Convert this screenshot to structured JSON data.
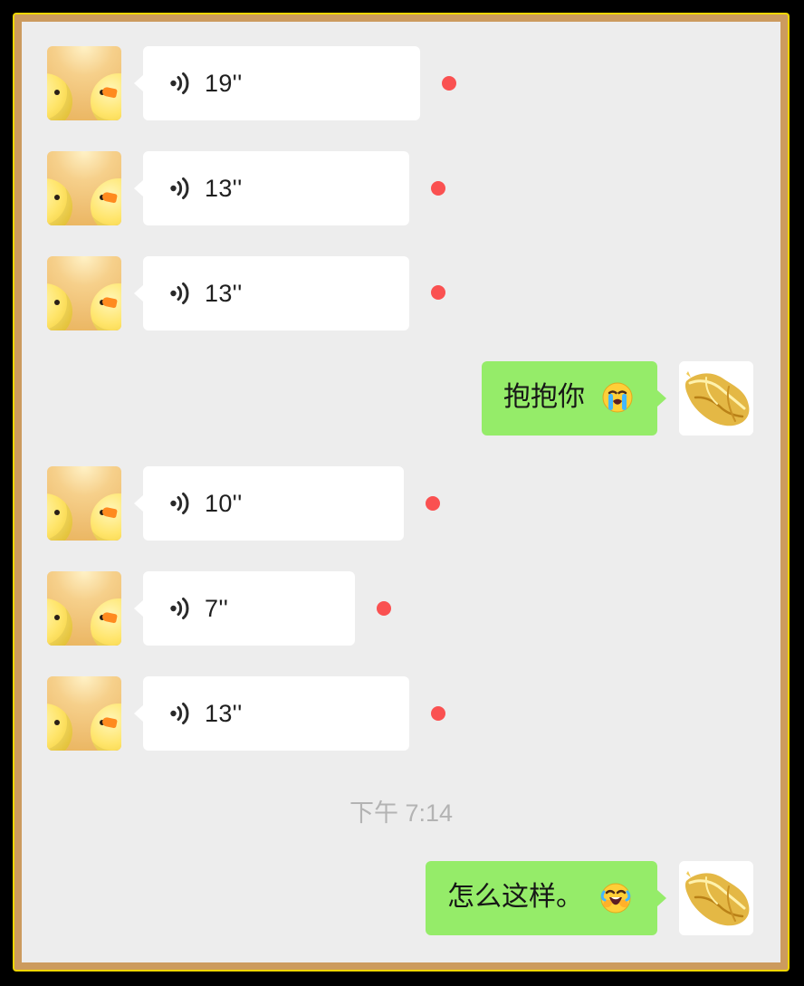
{
  "messages": [
    {
      "duration": "19''",
      "unread": true
    },
    {
      "duration": "13''",
      "unread": true
    },
    {
      "duration": "13''",
      "unread": true
    },
    {
      "text": "抱抱你"
    },
    {
      "duration": "10''",
      "unread": true
    },
    {
      "duration": "7''",
      "unread": true
    },
    {
      "duration": "13''",
      "unread": true
    },
    {
      "timestamp": "下午 7:14"
    },
    {
      "text": "怎么这样。"
    }
  ],
  "colors": {
    "background": "#ededed",
    "incoming_bubble": "#ffffff",
    "outgoing_bubble": "#95ec69",
    "unread_dot": "#fa5151",
    "timestamp_text": "#b3b3b3",
    "frame_border": "#cc9b5e"
  },
  "icons": {
    "voice": "voice-wave-icon",
    "emoji_1": "crying-face-icon",
    "emoji_2": "laugh-cry-face-icon"
  }
}
